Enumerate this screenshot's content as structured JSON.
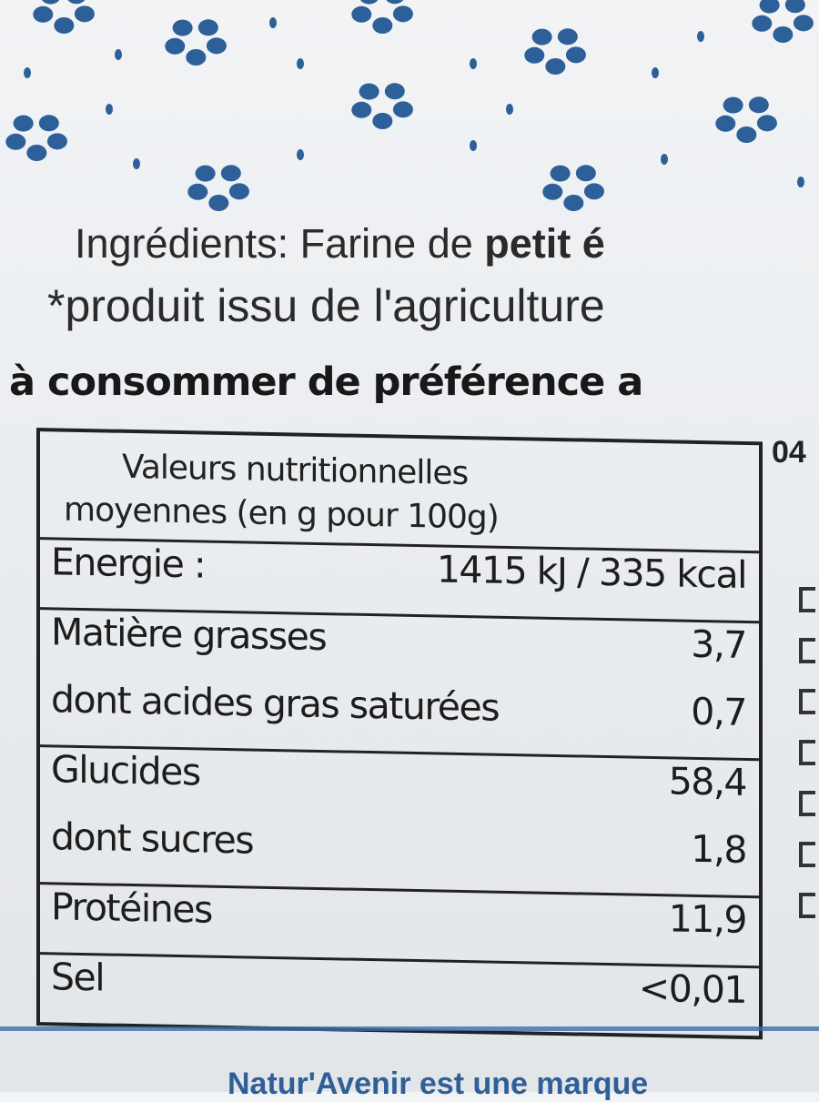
{
  "pattern": {
    "dot_color": "#2d5f98"
  },
  "label": {
    "ingredients_prefix": "Ingrédients: Farine de ",
    "ingredients_bold": "petit é",
    "organic_note": "*produit issu de l'agriculture",
    "best_before": "à consommer de préférence a",
    "lot_code": "04"
  },
  "nutrition": {
    "header_line1": "Valeurs nutritionnelles",
    "header_line2": "moyennes (en g pour 100g)",
    "energy_label": "Energie :",
    "energy_value": "1415 kJ / 335 kcal",
    "fat_label": "Matière grasses",
    "fat_value": "3,7",
    "satfat_label": "dont acides gras saturées",
    "satfat_value": "0,7",
    "carbs_label": "Glucides",
    "carbs_value": "58,4",
    "sugars_label": "dont sucres",
    "sugars_value": "1,8",
    "protein_label": "Protéines",
    "protein_value": "11,9",
    "salt_label": "Sel",
    "salt_value": "<0,01"
  },
  "footer": {
    "brand_text": "Natur'Avenir est une marque"
  }
}
